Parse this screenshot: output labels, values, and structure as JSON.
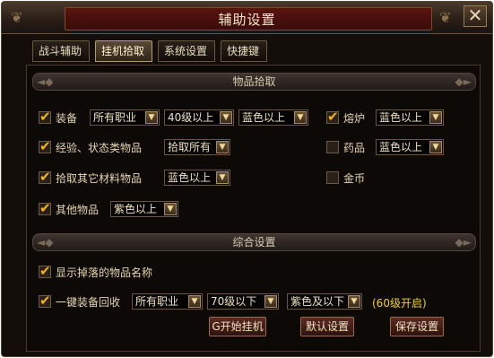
{
  "window": {
    "title": "辅助设置"
  },
  "tabs": [
    {
      "label": "战斗辅助"
    },
    {
      "label": "挂机拾取"
    },
    {
      "label": "系统设置"
    },
    {
      "label": "快捷键"
    }
  ],
  "pickup": {
    "header": "物品拾取",
    "equipment": {
      "label": "装备",
      "class_select": "所有职业",
      "level_select": "40级以上",
      "quality_select": "蓝色以上"
    },
    "exp_items": {
      "label": "经验、状态类物品",
      "select": "拾取所有"
    },
    "materials": {
      "label": "拾取其它材料物品",
      "select": "蓝色以上"
    },
    "other": {
      "label": "其他物品",
      "select": "紫色以上"
    },
    "furnace": {
      "label": "熔炉",
      "select": "蓝色以上"
    },
    "medicine": {
      "label": "药品",
      "select": "蓝色以上"
    },
    "gold": {
      "label": "金币"
    }
  },
  "general": {
    "header": "综合设置",
    "show_names": {
      "label": "显示掉落的物品名称"
    },
    "recycle": {
      "label": "一键装备回收",
      "class_select": "所有职业",
      "level_select": "70级以下",
      "quality_select": "紫色及以下",
      "note": "(60级开启)"
    }
  },
  "buttons": {
    "start": "G开始挂机",
    "default": "默认设置",
    "save": "保存设置"
  },
  "colors": {
    "title_plate": "#3a0b08",
    "accent": "#f2b418",
    "note": "#f0d020"
  }
}
